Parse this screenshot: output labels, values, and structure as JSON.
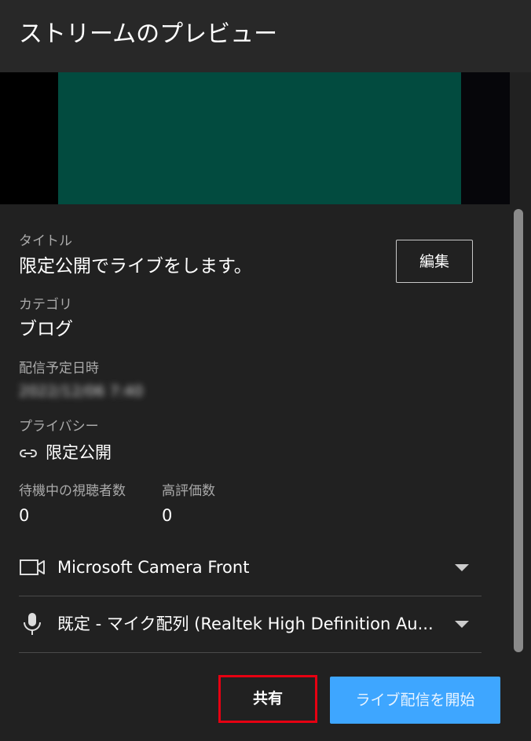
{
  "header": {
    "title": "ストリームのプレビュー"
  },
  "details": {
    "title_label": "タイトル",
    "title_value": "限定公開でライブをします。",
    "edit_label": "編集",
    "category_label": "カテゴリ",
    "category_value": "ブログ",
    "schedule_label": "配信予定日時",
    "schedule_value": "2022/12/06 7:40",
    "privacy_label": "プライバシー",
    "privacy_value": "限定公開",
    "privacy_icon": "link-icon",
    "waiting_viewers_label": "待機中の視聴者数",
    "waiting_viewers_value": "0",
    "likes_label": "高評価数",
    "likes_value": "0"
  },
  "devices": {
    "camera": {
      "icon": "camera-icon",
      "label": "Microsoft Camera Front"
    },
    "microphone": {
      "icon": "microphone-icon",
      "label": "既定 - マイク配列 (Realtek High Definition Au..."
    }
  },
  "actions": {
    "share_label": "共有",
    "start_label": "ライブ配信を開始"
  },
  "colors": {
    "background": "#212121",
    "header": "#282828",
    "preview_video": "#024b3f",
    "primary_button": "#3ea6ff",
    "highlight": "#e60012"
  }
}
